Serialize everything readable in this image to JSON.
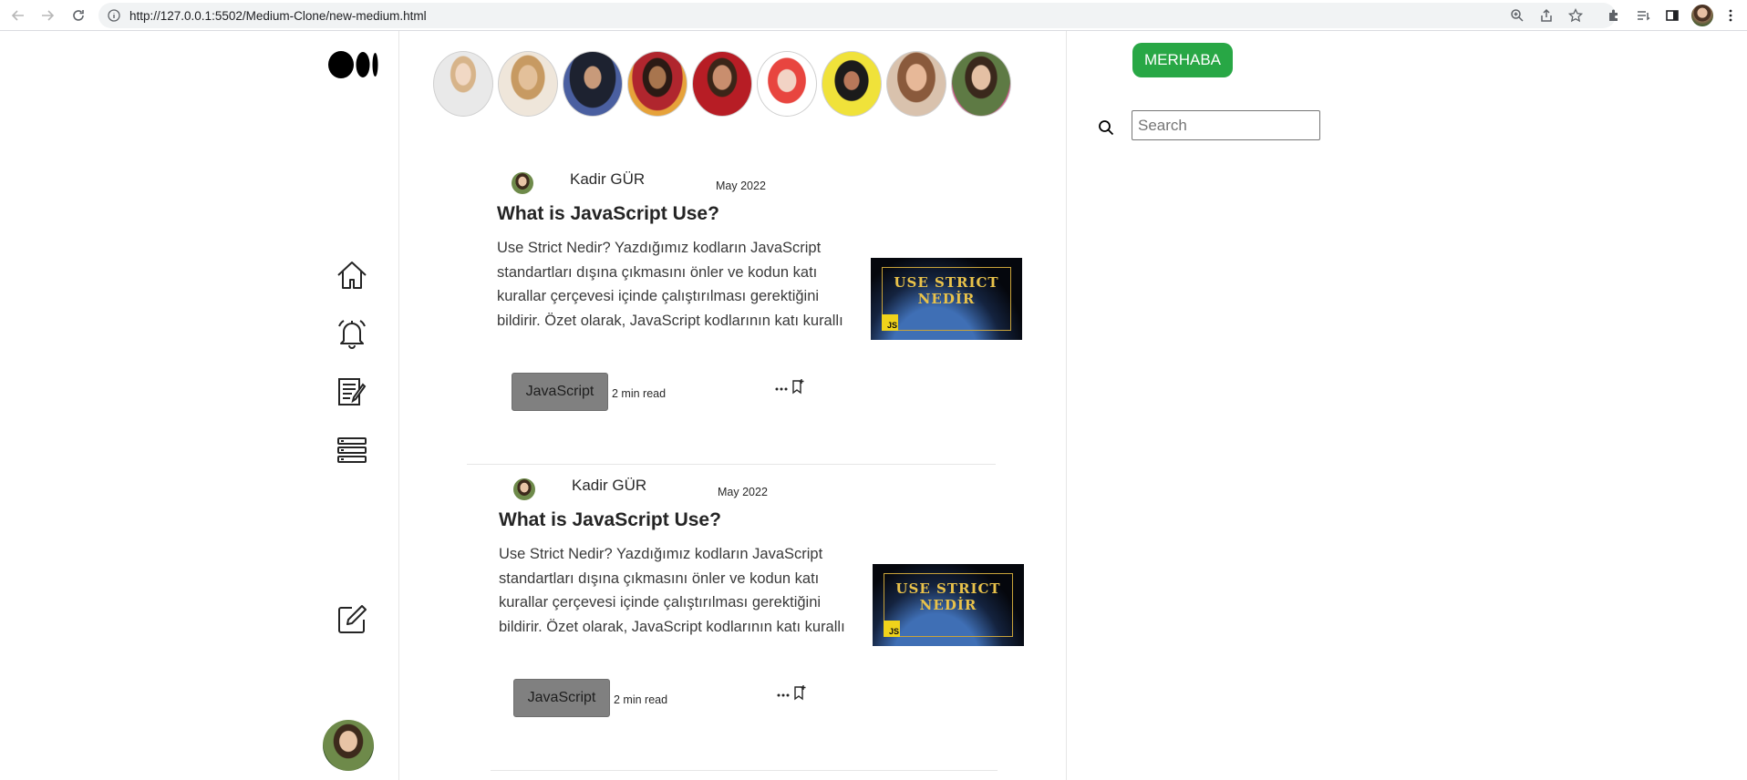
{
  "browser": {
    "url": "http://127.0.0.1:5502/Medium-Clone/new-medium.html"
  },
  "sidebar": {
    "logo": "medium-logo",
    "icons": [
      "home-icon",
      "bell-icon",
      "stories-icon",
      "lists-icon",
      "write-icon"
    ]
  },
  "stories": {
    "count": 9
  },
  "posts": [
    {
      "author": "Kadir GÜR",
      "date": "May 2022",
      "title": "What is JavaScript Use?",
      "body": "Use Strict Nedir? Yazdığımız kodların JavaScript standartları dışına çıkmasını önler ve kodun katı kurallar çerçevesi içinde çalıştırılması gerektiğini bildirir. Özet olarak, JavaScript kodlarının katı kurallı",
      "thumb_title_line1": "USE STRICT",
      "thumb_title_line2": "NEDİR",
      "thumb_badge": "JS",
      "tag": "JavaScript",
      "read_time": "2 min read"
    },
    {
      "author": "Kadir GÜR",
      "date": "May 2022",
      "title": "What is JavaScript Use?",
      "body": "Use Strict Nedir? Yazdığımız kodların JavaScript standartları dışına çıkmasını önler ve kodun katı kurallar çerçevesi içinde çalıştırılması gerektiğini bildirir. Özet olarak, JavaScript kodlarının katı kurallı",
      "thumb_title_line1": "USE STRICT",
      "thumb_title_line2": "NEDİR",
      "thumb_badge": "JS",
      "tag": "JavaScript",
      "read_time": "2 min read"
    }
  ],
  "right": {
    "greeting_button": "MERHABA",
    "search_placeholder": "Search"
  }
}
